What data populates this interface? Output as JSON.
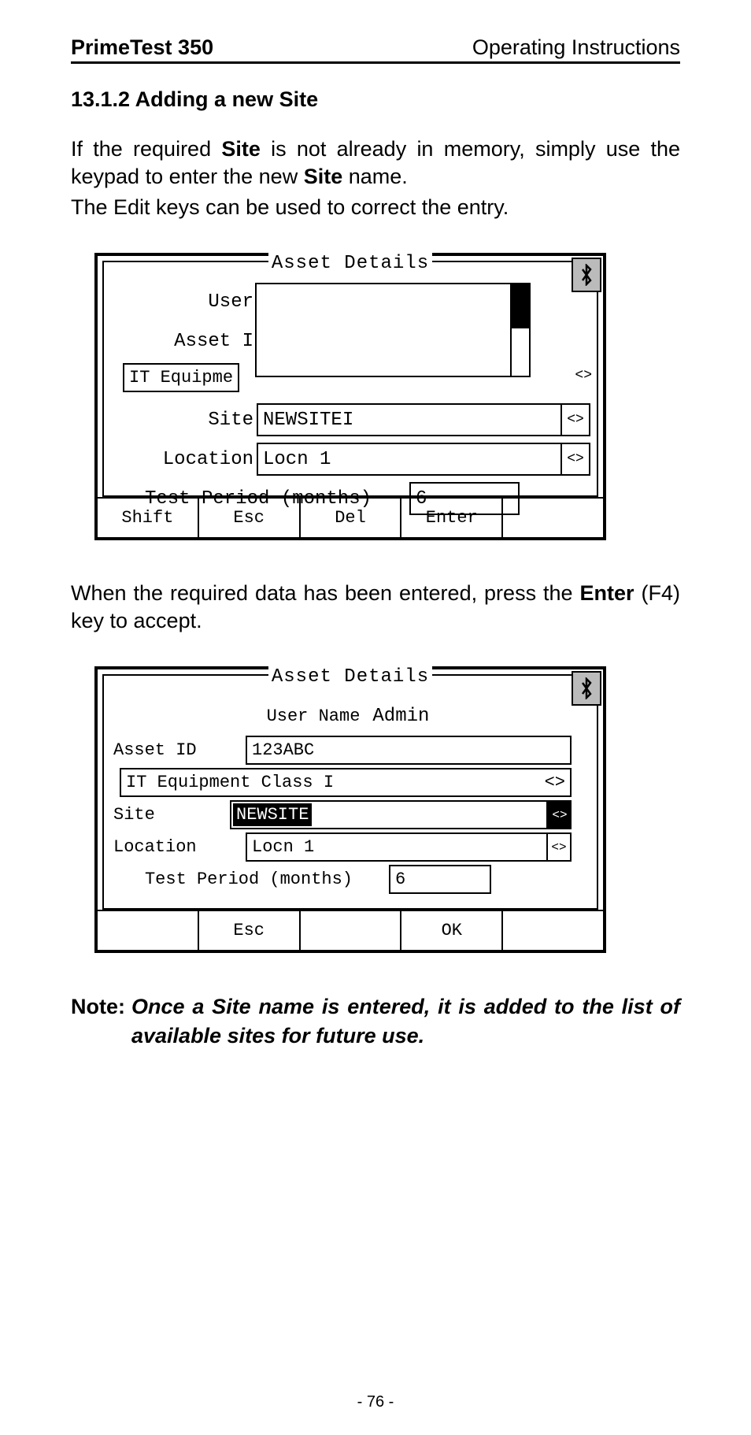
{
  "header": {
    "left": "PrimeTest 350",
    "right": "Operating Instructions"
  },
  "section": {
    "number": "13.1.2",
    "title": "Adding a new Site"
  },
  "paragraphs": {
    "p1a": "If the required ",
    "p1b": "Site",
    "p1c": " is not already in memory, simply use the keypad to enter the new ",
    "p1d": "Site",
    "p1e": " name.",
    "p2": "The Edit keys can be used to correct the entry.",
    "p3a": "When the required data has been entered, press the ",
    "p3b": "Enter",
    "p3c": " (F4) key to accept."
  },
  "screenshot1": {
    "title": "Asset Details",
    "bluetooth": "⁕",
    "labels": {
      "user": "User",
      "asset": "Asset I",
      "it": "IT Equipme",
      "site": "Site",
      "location": "Location",
      "testperiod": "Test Period (months)"
    },
    "values": {
      "site": "NEWSITEI",
      "location": "Locn 1",
      "testperiod": "6"
    },
    "arrows": {
      "k": "<>",
      "lr": "<>"
    },
    "softkeys": [
      "Shift",
      "Esc",
      "Del",
      "Enter",
      ""
    ]
  },
  "screenshot2": {
    "title": "Asset Details",
    "bluetooth": "⁕",
    "labels": {
      "user": "User Name",
      "asset": "Asset ID",
      "itrow": "IT Equipment Class I",
      "site": "Site",
      "location": "Location",
      "testperiod": "Test Period (months)"
    },
    "values": {
      "user": "Admin",
      "asset": "123ABC",
      "site": "NEWSITE",
      "location": "Locn 1",
      "testperiod": "6"
    },
    "arrows": {
      "lr": "<>"
    },
    "softkeys": [
      "",
      "Esc",
      "",
      "OK",
      ""
    ]
  },
  "note": {
    "label": "Note:",
    "body": "Once a Site name is entered, it is added to the list of available sites for future use."
  },
  "page_number": "- 76 -"
}
